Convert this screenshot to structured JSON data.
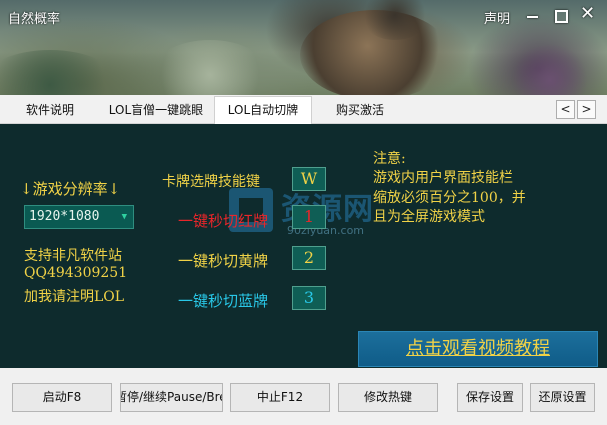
{
  "window": {
    "title": "自然概率",
    "declare_label": "声明",
    "close_glyph": "✕"
  },
  "tabs": [
    {
      "label": "软件说明"
    },
    {
      "label": "LOL盲僧一键跳眼"
    },
    {
      "label": "LOL自动切牌"
    },
    {
      "label": "购买激活"
    }
  ],
  "tab_nav": {
    "prev": "<",
    "next": ">"
  },
  "resolution": {
    "label": "↓游戏分辨率↓",
    "selected": "1920*1080"
  },
  "support": {
    "line1": "支持非凡软件站",
    "line2": "QQ494309251",
    "line3": "加我请注明LOL"
  },
  "skill": {
    "label": "卡牌选牌技能键",
    "key": "W"
  },
  "cards": [
    {
      "label": "一键秒切红牌",
      "key": "1",
      "color": "#e8262a"
    },
    {
      "label": "一键秒切黄牌",
      "key": "2",
      "color": "#f0d247"
    },
    {
      "label": "一键秒切蓝牌",
      "key": "3",
      "color": "#29c8e8"
    }
  ],
  "note": {
    "title": "注意:",
    "line1": "游戏内用户界面技能栏",
    "line2": "缩放必须百分之100，并",
    "line3": "且为全屏游戏模式"
  },
  "watermark": {
    "text": "资源网",
    "url": "90ziyuan.com"
  },
  "video_button": "点击观看视频教程",
  "bottom_buttons": {
    "start": "启动F8",
    "pause": "暂停/继续Pause/Break",
    "stop": "中止F12",
    "hotkey": "修改热键",
    "save": "保存设置",
    "restore": "还原设置"
  },
  "colors": {
    "accent_yellow": "#f0d247",
    "panel_bg": "#0e2b2d",
    "key_bg": "#0f5e55",
    "video_btn": "#1c6f9c"
  }
}
